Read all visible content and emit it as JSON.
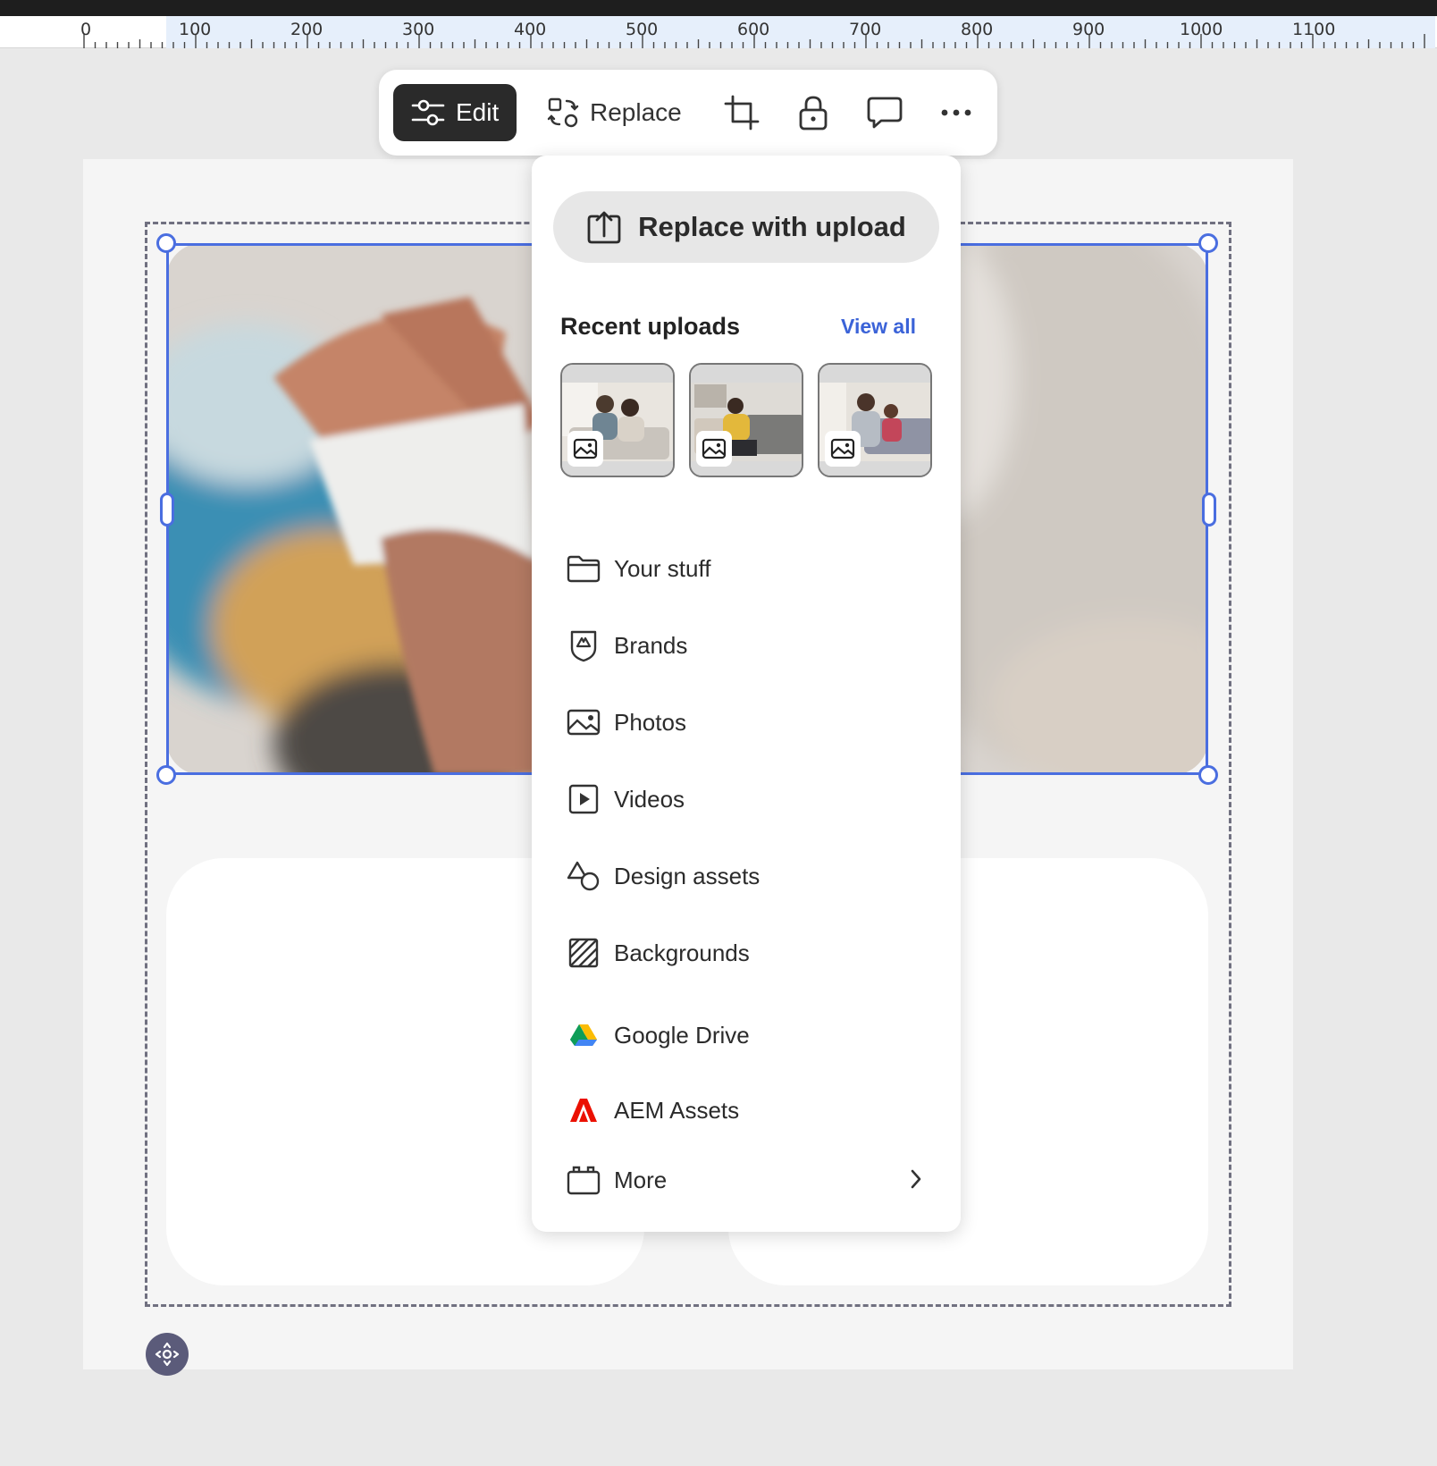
{
  "ruler": {
    "labels": [
      "0",
      "100",
      "200",
      "300",
      "400",
      "500",
      "600",
      "700",
      "800",
      "900",
      "1000",
      "1100"
    ]
  },
  "toolbar": {
    "edit_label": "Edit",
    "replace_label": "Replace",
    "icons": [
      "sliders-icon",
      "swap-icon",
      "crop-icon",
      "lock-icon",
      "comment-icon",
      "more-icon"
    ]
  },
  "replace_menu": {
    "upload_label": "Replace with upload",
    "recent_title": "Recent uploads",
    "view_all": "View all",
    "thumbnails": [
      "recent-upload-1",
      "recent-upload-2",
      "recent-upload-3"
    ],
    "items": [
      {
        "label": "Your stuff",
        "icon": "folder-icon"
      },
      {
        "label": "Brands",
        "icon": "brand-icon"
      },
      {
        "label": "Photos",
        "icon": "photo-icon"
      },
      {
        "label": "Videos",
        "icon": "video-icon"
      },
      {
        "label": "Design assets",
        "icon": "shapes-icon"
      },
      {
        "label": "Backgrounds",
        "icon": "pattern-icon"
      },
      {
        "label": "Google Drive",
        "icon": "google-drive-icon"
      },
      {
        "label": "AEM Assets",
        "icon": "adobe-icon"
      },
      {
        "label": "More",
        "icon": "briefcase-icon"
      }
    ]
  },
  "colors": {
    "selection": "#4a6ee0",
    "link": "#3b63d8",
    "edit_button_bg": "#2a2a2a"
  }
}
